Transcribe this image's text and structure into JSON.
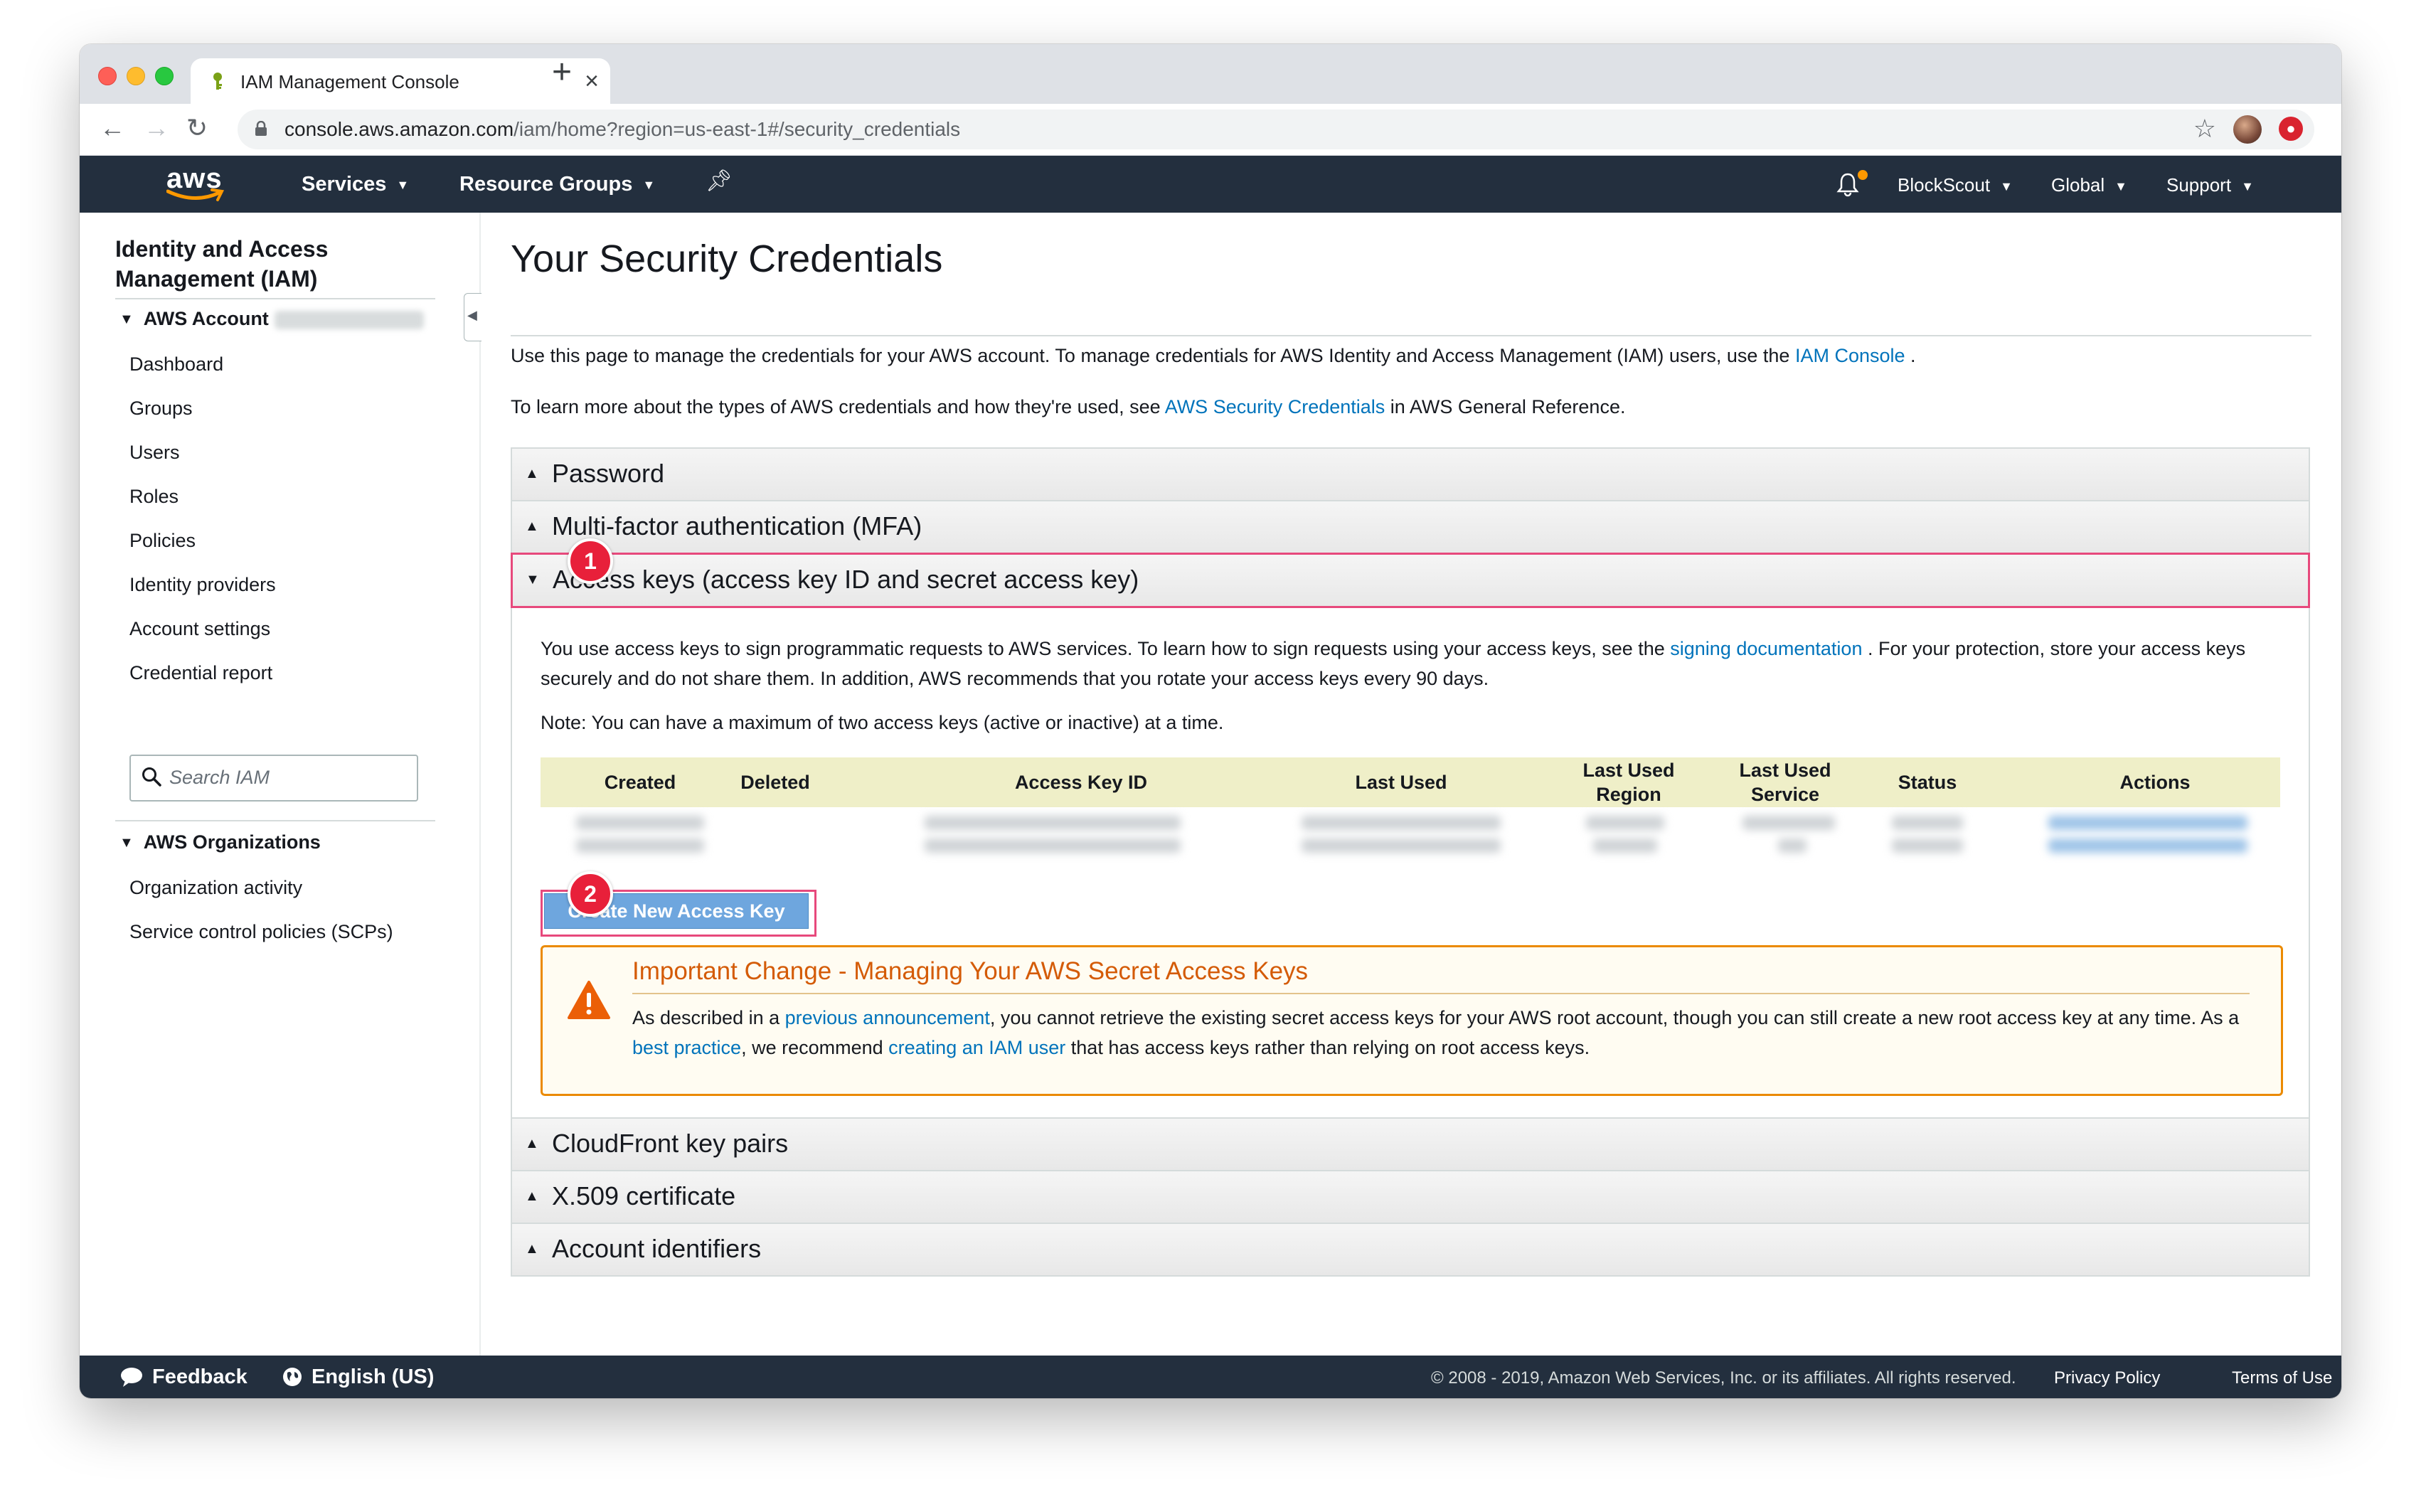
{
  "browser": {
    "tab_title": "IAM Management Console",
    "tab_close": "×",
    "new_tab": "+",
    "url_host": "console.aws.amazon.com",
    "url_path": "/iam/home?region=us-east-1#/security_credentials"
  },
  "topnav": {
    "logo": "aws",
    "services": "Services",
    "resource_groups": "Resource Groups",
    "account": "BlockScout",
    "region": "Global",
    "support": "Support",
    "colors": {
      "bar": "#232f3e",
      "accent": "#ff9900"
    }
  },
  "sidebar": {
    "title": "Identity and Access Management (IAM)",
    "account_group": "AWS Account",
    "items": [
      "Dashboard",
      "Groups",
      "Users",
      "Roles",
      "Policies",
      "Identity providers",
      "Account settings",
      "Credential report"
    ],
    "search_placeholder": "Search IAM",
    "org_group": "AWS Organizations",
    "org_items": [
      "Organization activity",
      "Service control policies (SCPs)"
    ]
  },
  "main": {
    "title": "Your Security Credentials",
    "intro1_pre": "Use this page to manage the credentials for your AWS account. To manage credentials for AWS Identity and Access Management (IAM) users, use the ",
    "intro1_link": "IAM Console",
    "intro1_post": " .",
    "intro2_pre": "To learn more about the types of AWS credentials and how they're used, see ",
    "intro2_link": "AWS Security Credentials",
    "intro2_post": " in AWS General Reference.",
    "sections": {
      "password": "Password",
      "mfa": "Multi-factor authentication (MFA)",
      "access_keys": "Access keys (access key ID and secret access key)",
      "cloudfront": "CloudFront key pairs",
      "x509": "X.509 certificate",
      "account_ids": "Account identifiers"
    },
    "access_keys": {
      "desc_pre": "You use access keys to sign programmatic requests to AWS services. To learn how to sign requests using your access keys, see the ",
      "desc_link": "signing documentation",
      "desc_post": " . For your protection, store your access keys securely and do not share them. In addition, AWS recommends that you rotate your access keys every 90 days.",
      "note": "Note: You can have a maximum of two access keys (active or inactive) at a time.",
      "columns": [
        "Created",
        "Deleted",
        "Access Key ID",
        "Last Used",
        "Last Used Region",
        "Last Used Service",
        "Status",
        "Actions"
      ],
      "create_button": "Create New Access Key"
    },
    "alert": {
      "title": "Important Change - Managing Your AWS Secret Access Keys",
      "t1": "As described in a ",
      "l1": "previous announcement",
      "t2": ", you cannot retrieve the existing secret access keys for your AWS root account, though you can still create a new root access key at any time. As a ",
      "l2": "best practice",
      "t3": ", we recommend ",
      "l3": "creating an IAM user",
      "t4": " that has access keys rather than relying on root access keys."
    },
    "annotations": [
      "1",
      "2"
    ]
  },
  "footer": {
    "feedback": "Feedback",
    "language": "English (US)",
    "copyright": "© 2008 - 2019, Amazon Web Services, Inc. or its affiliates. All rights reserved.",
    "privacy": "Privacy Policy",
    "terms": "Terms of Use"
  }
}
